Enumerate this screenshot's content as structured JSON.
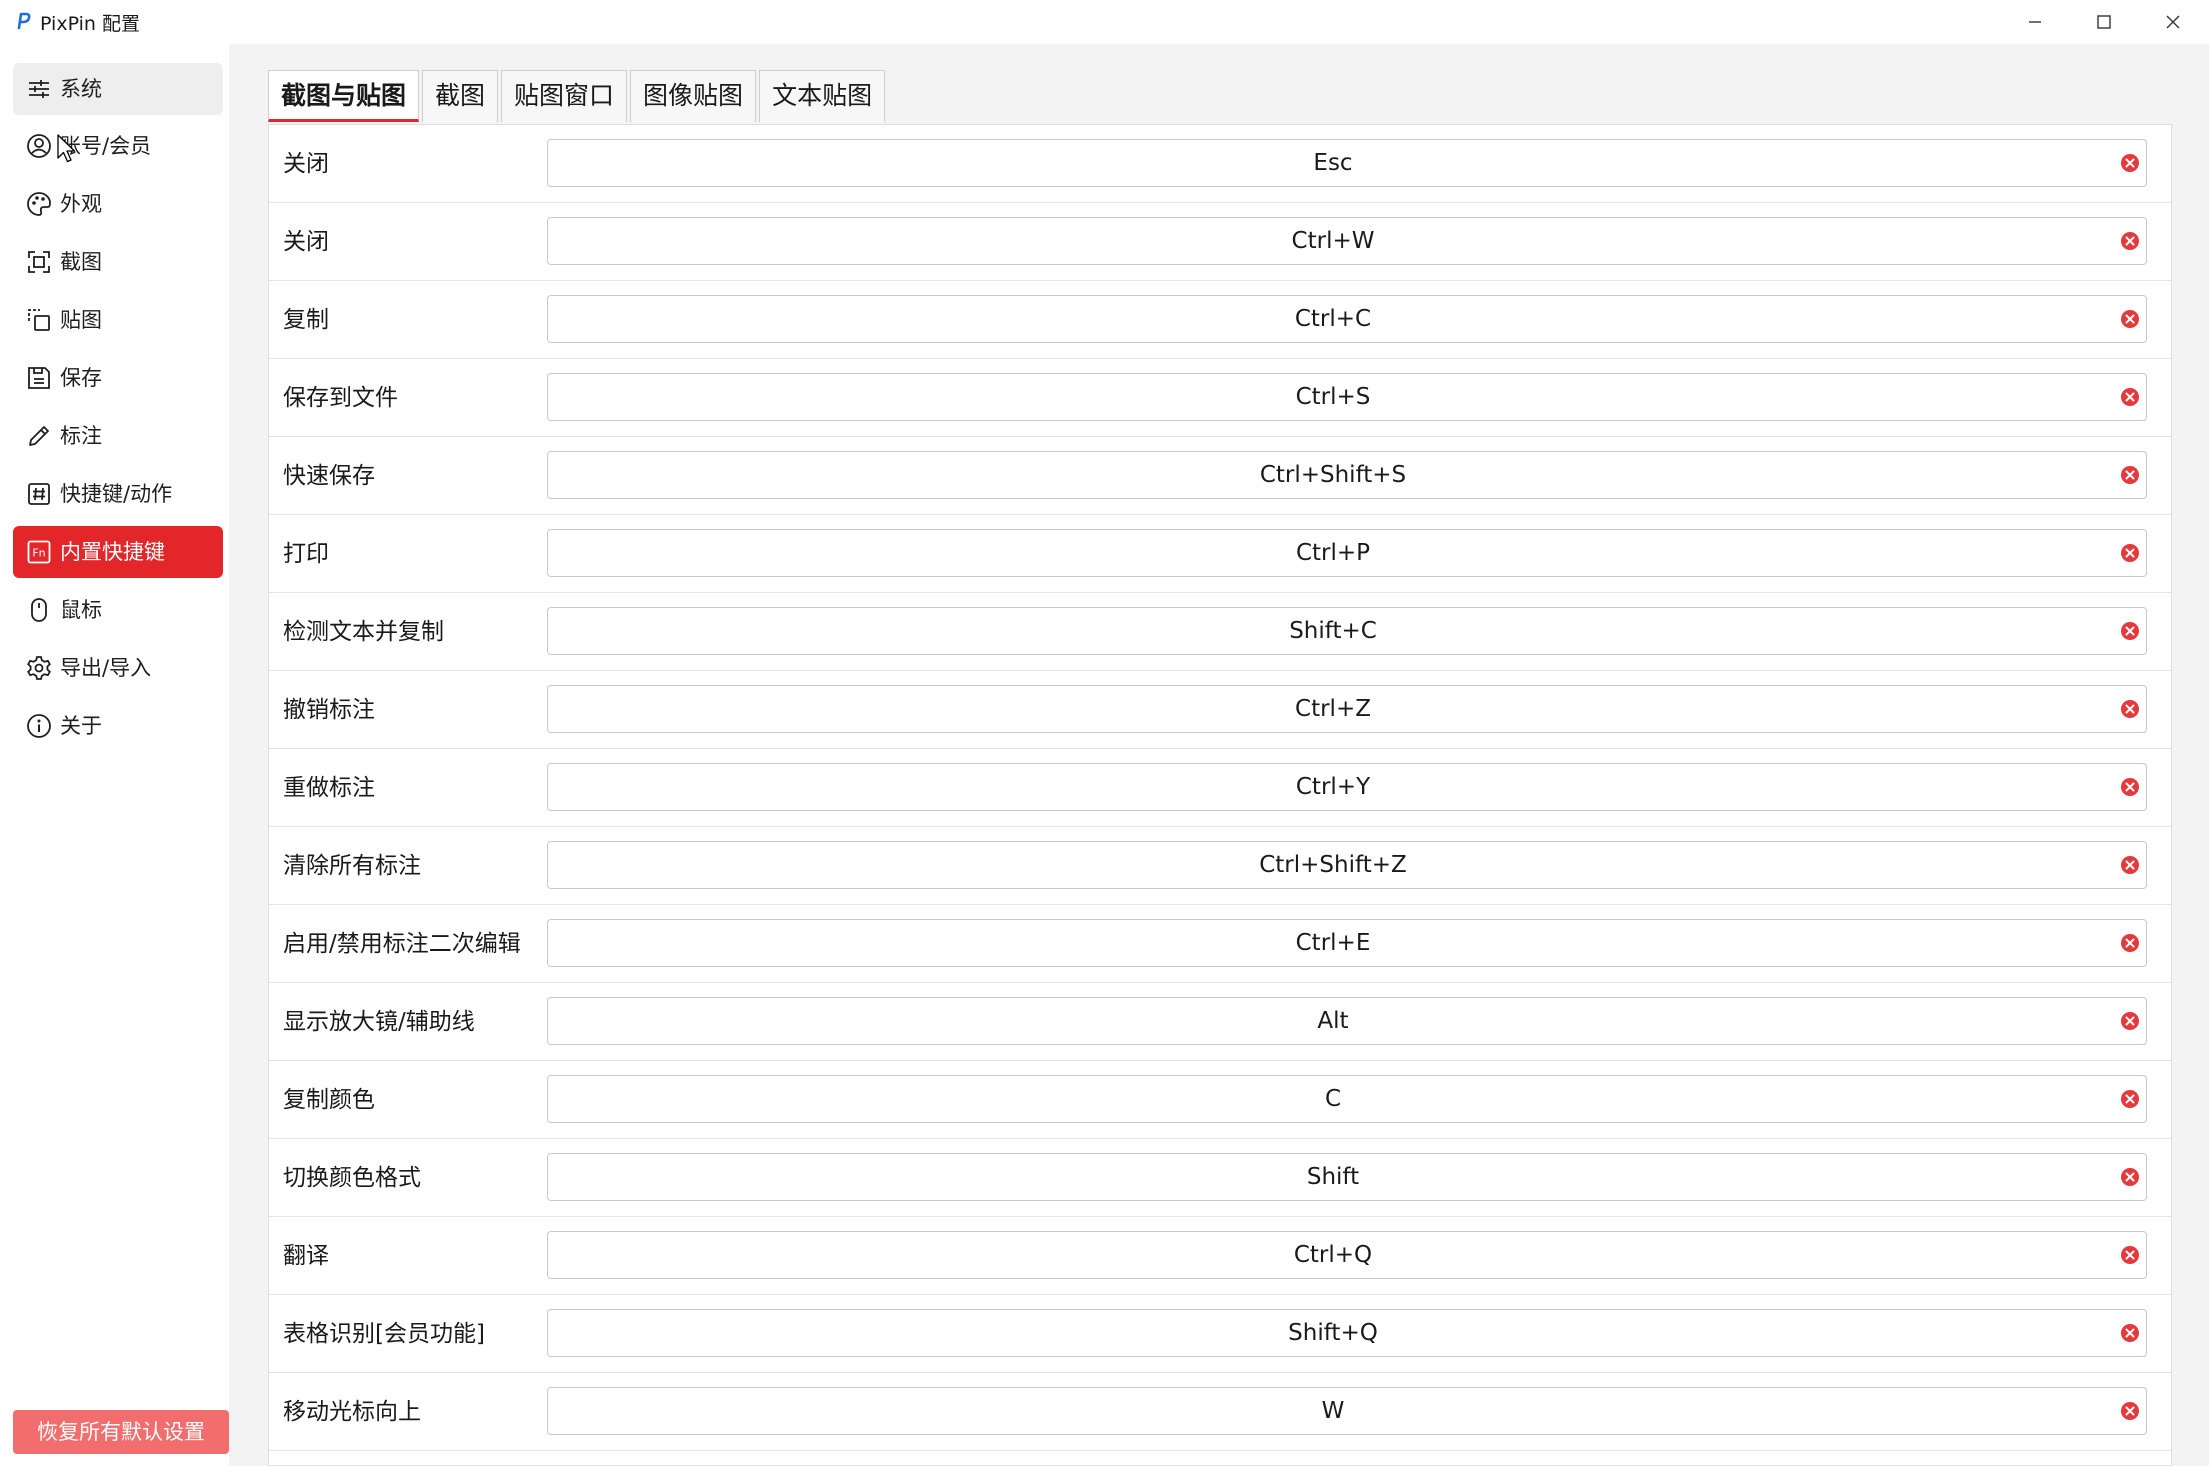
{
  "window": {
    "title": "PixPin 配置"
  },
  "sidebar": {
    "items": [
      {
        "label": "系统",
        "icon": "sliders-icon",
        "state": "hover"
      },
      {
        "label": "账号/会员",
        "icon": "user-circle-icon",
        "state": ""
      },
      {
        "label": "外观",
        "icon": "palette-icon",
        "state": ""
      },
      {
        "label": "截图",
        "icon": "screenshot-frame-icon",
        "state": ""
      },
      {
        "label": "贴图",
        "icon": "pin-copy-icon",
        "state": ""
      },
      {
        "label": "保存",
        "icon": "save-icon",
        "state": ""
      },
      {
        "label": "标注",
        "icon": "pencil-icon",
        "state": ""
      },
      {
        "label": "快捷键/动作",
        "icon": "hash-box-icon",
        "state": ""
      },
      {
        "label": "内置快捷键",
        "icon": "fn-key-icon",
        "state": "active"
      },
      {
        "label": "鼠标",
        "icon": "mouse-icon",
        "state": ""
      },
      {
        "label": "导出/导入",
        "icon": "gear-icon",
        "state": ""
      },
      {
        "label": "关于",
        "icon": "info-icon",
        "state": ""
      }
    ],
    "reset_label": "恢复所有默认设置"
  },
  "tabs": [
    {
      "label": "截图与贴图",
      "active": true
    },
    {
      "label": "截图",
      "active": false
    },
    {
      "label": "贴图窗口",
      "active": false
    },
    {
      "label": "图像贴图",
      "active": false
    },
    {
      "label": "文本贴图",
      "active": false
    }
  ],
  "shortcuts": [
    {
      "label": "关闭",
      "key": "Esc"
    },
    {
      "label": "关闭",
      "key": "Ctrl+W"
    },
    {
      "label": "复制",
      "key": "Ctrl+C"
    },
    {
      "label": "保存到文件",
      "key": "Ctrl+S"
    },
    {
      "label": "快速保存",
      "key": "Ctrl+Shift+S"
    },
    {
      "label": "打印",
      "key": "Ctrl+P"
    },
    {
      "label": "检测文本并复制",
      "key": "Shift+C"
    },
    {
      "label": "撤销标注",
      "key": "Ctrl+Z"
    },
    {
      "label": "重做标注",
      "key": "Ctrl+Y"
    },
    {
      "label": "清除所有标注",
      "key": "Ctrl+Shift+Z"
    },
    {
      "label": "启用/禁用标注二次编辑",
      "key": "Ctrl+E"
    },
    {
      "label": "显示放大镜/辅助线",
      "key": "Alt"
    },
    {
      "label": "复制颜色",
      "key": "C"
    },
    {
      "label": "切换颜色格式",
      "key": "Shift"
    },
    {
      "label": "翻译",
      "key": "Ctrl+Q"
    },
    {
      "label": "表格识别[会员功能]",
      "key": "Shift+Q"
    },
    {
      "label": "移动光标向上",
      "key": "W"
    }
  ],
  "colors": {
    "accent": "#e32629",
    "reset_button": "#f26d6d",
    "clear_icon": "#e5393b"
  }
}
